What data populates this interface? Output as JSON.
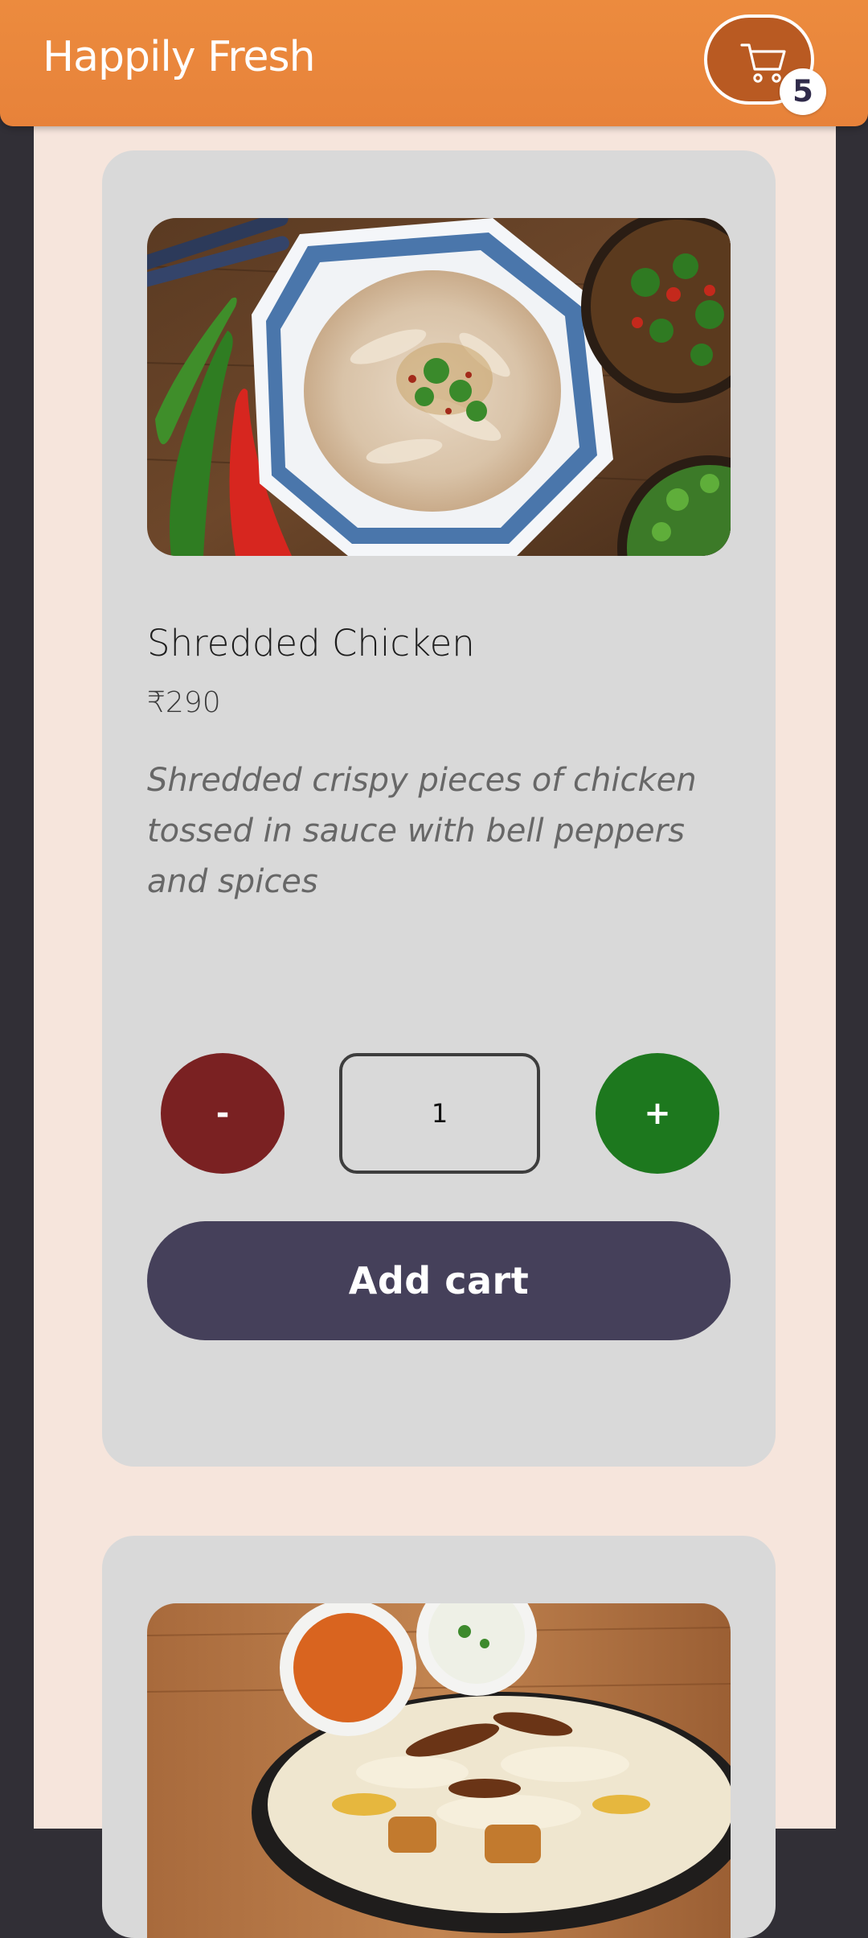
{
  "header": {
    "brand": "Happily Fresh",
    "cart_icon": "cart-icon",
    "cart_count": "5",
    "accent_color": "#e8843a"
  },
  "products": [
    {
      "name": "Shredded Chicken",
      "price": "₹290",
      "description": "Shredded crispy pieces of chicken tossed in sauce with bell peppers and spices",
      "quantity": "1",
      "minus_label": "-",
      "plus_label": "+",
      "add_label": "Add cart"
    }
  ],
  "colors": {
    "page_bg": "#312f36",
    "panel_bg": "#f6e5dc",
    "card_bg": "#d9d9d9",
    "minus_button": "#7a2122",
    "plus_button": "#1d781e",
    "add_cart_button": "#45405a"
  }
}
